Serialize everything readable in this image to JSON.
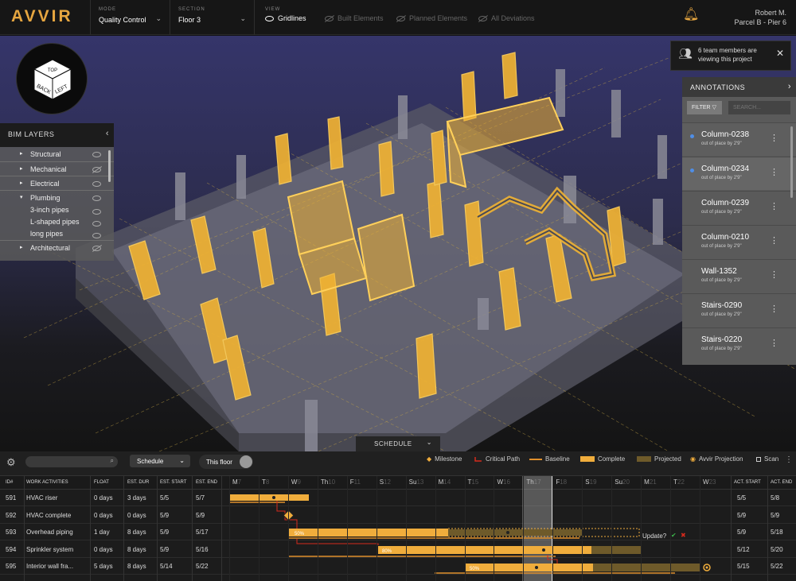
{
  "topbar": {
    "logo": "AVVIR",
    "mode": {
      "label": "MODE",
      "value": "Quality Control"
    },
    "section": {
      "label": "SECTION",
      "value": "Floor 3"
    },
    "view": {
      "label": "VIEW",
      "options": [
        {
          "label": "Gridlines",
          "active": true
        },
        {
          "label": "Built Elements",
          "active": false
        },
        {
          "label": "Planned Elements",
          "active": false
        },
        {
          "label": "All Deviations",
          "active": false
        }
      ]
    },
    "user": {
      "name": "Robert M.",
      "project": "Parcel B - Pier 6"
    }
  },
  "viewcube": {
    "faces": [
      "TOP",
      "BACK",
      "LEFT"
    ]
  },
  "bim_layers": {
    "title": "BIM LAYERS",
    "items": [
      {
        "label": "Structural",
        "expanded": false,
        "visible": true
      },
      {
        "label": "Mechanical",
        "expanded": false,
        "visible": false
      },
      {
        "label": "Electrical",
        "expanded": false,
        "visible": true
      },
      {
        "label": "Plumbing",
        "expanded": true,
        "visible": true,
        "children": [
          "3-inch pipes",
          "L-shaped pipes",
          "long pipes"
        ]
      },
      {
        "label": "Architectural",
        "expanded": false,
        "visible": false
      }
    ]
  },
  "toast": {
    "text_line1": "6 team members are",
    "text_line2": "viewing this project"
  },
  "annotations": {
    "title": "ANNOTATIONS",
    "filter_label": "FILTER",
    "search_placeholder": "SEARCH...",
    "items": [
      {
        "name": "Column-0238",
        "detail": "out of place by 2'9\"",
        "unread": true
      },
      {
        "name": "Column-0234",
        "detail": "out of place by 2'9\"",
        "unread": true
      },
      {
        "name": "Column-0239",
        "detail": "out of place by 2'9\"",
        "unread": false
      },
      {
        "name": "Column-0210",
        "detail": "out of place by 2'9\"",
        "unread": false
      },
      {
        "name": "Wall-1352",
        "detail": "out of place by 2'9\"",
        "unread": false
      },
      {
        "name": "Stairs-0290",
        "detail": "out of place by 2'9\"",
        "unread": false
      },
      {
        "name": "Stairs-0220",
        "detail": "out of place by 2'9\"",
        "unread": false
      }
    ]
  },
  "schedule": {
    "tab_label": "SCHEDULE",
    "view_select": "Schedule",
    "toggle_label": "This floor",
    "legend": [
      "Milestone",
      "Critical Path",
      "Baseline",
      "Complete",
      "Projected",
      "Avvir Projection",
      "Scan"
    ],
    "colors": {
      "complete": "#f0ad3c",
      "projected": "#6e5a2a",
      "baseline": "#e0902c",
      "critical": "#d42a1c"
    },
    "columns": {
      "id": "ID#",
      "activity": "WORK ACTIVITIES",
      "float": "FLOAT",
      "dur": "EST. DUR",
      "start": "EST. START",
      "end": "EST. END",
      "act_start": "ACT. START",
      "act_end": "ACT. END"
    },
    "days": [
      {
        "d": "M",
        "n": "7"
      },
      {
        "d": "T",
        "n": "8"
      },
      {
        "d": "W",
        "n": "9"
      },
      {
        "d": "Th",
        "n": "10"
      },
      {
        "d": "F",
        "n": "11"
      },
      {
        "d": "S",
        "n": "12"
      },
      {
        "d": "Su",
        "n": "13"
      },
      {
        "d": "M",
        "n": "14"
      },
      {
        "d": "T",
        "n": "15"
      },
      {
        "d": "W",
        "n": "16"
      },
      {
        "d": "Th",
        "n": "17"
      },
      {
        "d": "F",
        "n": "18"
      },
      {
        "d": "S",
        "n": "19"
      },
      {
        "d": "Su",
        "n": "20"
      },
      {
        "d": "M",
        "n": "21"
      },
      {
        "d": "T",
        "n": "22"
      },
      {
        "d": "W",
        "n": "23"
      }
    ],
    "rows": [
      {
        "id": "591",
        "activity": "HVAC riser",
        "float": "0 days",
        "dur": "3 days",
        "start": "5/5",
        "end": "5/7",
        "act_start": "5/5",
        "act_end": "5/8"
      },
      {
        "id": "592",
        "activity": "HVAC complete",
        "float": "0 days",
        "dur": "0 days",
        "start": "5/9",
        "end": "5/9",
        "act_start": "5/9",
        "act_end": "5/9"
      },
      {
        "id": "593",
        "activity": "Overhead piping",
        "float": "1 day",
        "dur": "8 days",
        "start": "5/9",
        "end": "5/17",
        "act_start": "5/9",
        "act_end": "5/18"
      },
      {
        "id": "594",
        "activity": "Sprinkler system",
        "float": "0 days",
        "dur": "8 days",
        "start": "5/9",
        "end": "5/16",
        "act_start": "5/12",
        "act_end": "5/20"
      },
      {
        "id": "595",
        "activity": "Interior wall fra...",
        "float": "5 days",
        "dur": "8 days",
        "start": "5/14",
        "end": "5/22",
        "act_start": "5/15",
        "act_end": "5/22"
      }
    ],
    "bar_labels": [
      "50%",
      "80%",
      "50%"
    ],
    "update_label": "Update?"
  }
}
